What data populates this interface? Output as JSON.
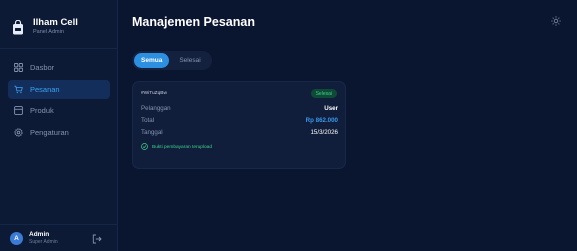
{
  "brand": {
    "name": "Ilham Cell",
    "subtitle": "Panel Admin"
  },
  "sidebar": {
    "items": [
      {
        "label": "Dasbor",
        "icon": "dashboard-icon",
        "active": false
      },
      {
        "label": "Pesanan",
        "icon": "cart-icon",
        "active": true
      },
      {
        "label": "Produk",
        "icon": "box-icon",
        "active": false
      },
      {
        "label": "Pengaturan",
        "icon": "gear-icon",
        "active": false
      }
    ]
  },
  "user": {
    "initial": "A",
    "name": "Admin",
    "role": "Super Admin"
  },
  "header": {
    "title": "Manajemen Pesanan"
  },
  "tabs": [
    {
      "label": "Semua",
      "active": true
    },
    {
      "label": "Selesai",
      "active": false
    }
  ],
  "orders": [
    {
      "id": "#WiTuZqBw",
      "status": "Selesai",
      "customer_label": "Pelanggan",
      "customer": "User",
      "total_label": "Total",
      "total": "Rp 862.000",
      "date_label": "Tanggal",
      "date": "15/3/2026",
      "proof": "Bukti pembayaran terupload"
    }
  ],
  "colors": {
    "accent": "#2d8fe0",
    "success": "#3ed08a",
    "background": "#0a1530"
  }
}
